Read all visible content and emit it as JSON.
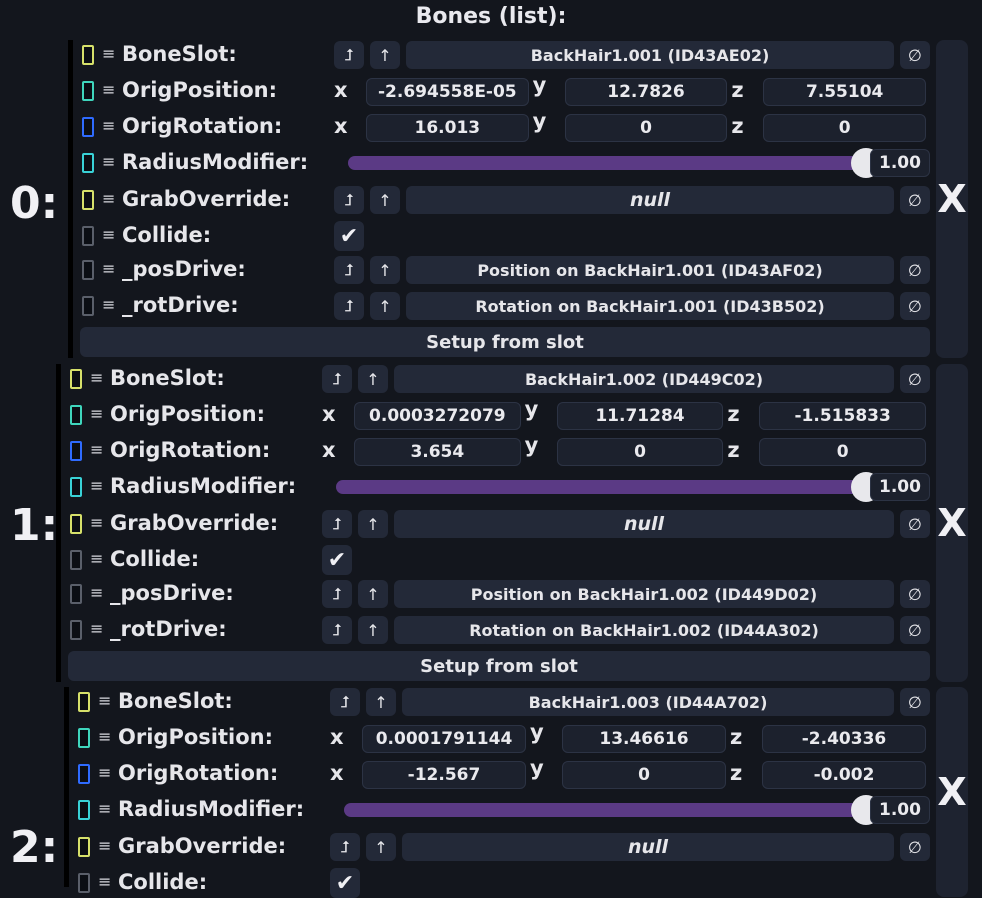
{
  "title": "Bones (list):",
  "labels": {
    "bone_slot": "BoneSlot:",
    "orig_position": "OrigPosition:",
    "orig_rotation": "OrigRotation:",
    "radius_modifier": "RadiusModifier:",
    "grab_override": "GrabOverride:",
    "collide": "Collide:",
    "pos_drive": "_posDrive:",
    "rot_drive": "_rotDrive:",
    "setup": "Setup from slot",
    "x": "x",
    "y": "y",
    "z": "z",
    "remove": "X",
    "clear": "∅",
    "jump": "⮥",
    "up": "↑",
    "grip": "≡",
    "check": "✔"
  },
  "colors": {
    "ref_icon": "#d6e06a",
    "vec3_icon": "#3fd6bd",
    "quat_icon": "#2f6bff",
    "float_icon": "#39d2d7",
    "bool_icon": "#5a5f6a",
    "slider": "#5b3a85"
  },
  "bones": [
    {
      "index": "0:",
      "bone_slot": "BackHair1.001 (ID43AE02)",
      "pos": {
        "x": "-2.694558E-05",
        "y": "12.7826",
        "z": "7.55104"
      },
      "rot": {
        "x": "16.013",
        "y": "0",
        "z": "0"
      },
      "radius": "1.00",
      "radius_value": 1.0,
      "grab_override": "null",
      "collide": true,
      "pos_drive": "Position on BackHair1.001 (ID43AF02)",
      "rot_drive": "Rotation on BackHair1.001 (ID43B502)"
    },
    {
      "index": "1:",
      "bone_slot": "BackHair1.002 (ID449C02)",
      "pos": {
        "x": "0.0003272079",
        "y": "11.71284",
        "z": "-1.515833"
      },
      "rot": {
        "x": "3.654",
        "y": "0",
        "z": "0"
      },
      "radius": "1.00",
      "radius_value": 1.0,
      "grab_override": "null",
      "collide": true,
      "pos_drive": "Position on BackHair1.002 (ID449D02)",
      "rot_drive": "Rotation on BackHair1.002 (ID44A302)"
    },
    {
      "index": "2:",
      "bone_slot": "BackHair1.003 (ID44A702)",
      "pos": {
        "x": "0.0001791144",
        "y": "13.46616",
        "z": "-2.40336"
      },
      "rot": {
        "x": "-12.567",
        "y": "0",
        "z": "-0.002"
      },
      "radius": "1.00",
      "radius_value": 1.0,
      "grab_override": "null",
      "collide": true
    }
  ]
}
